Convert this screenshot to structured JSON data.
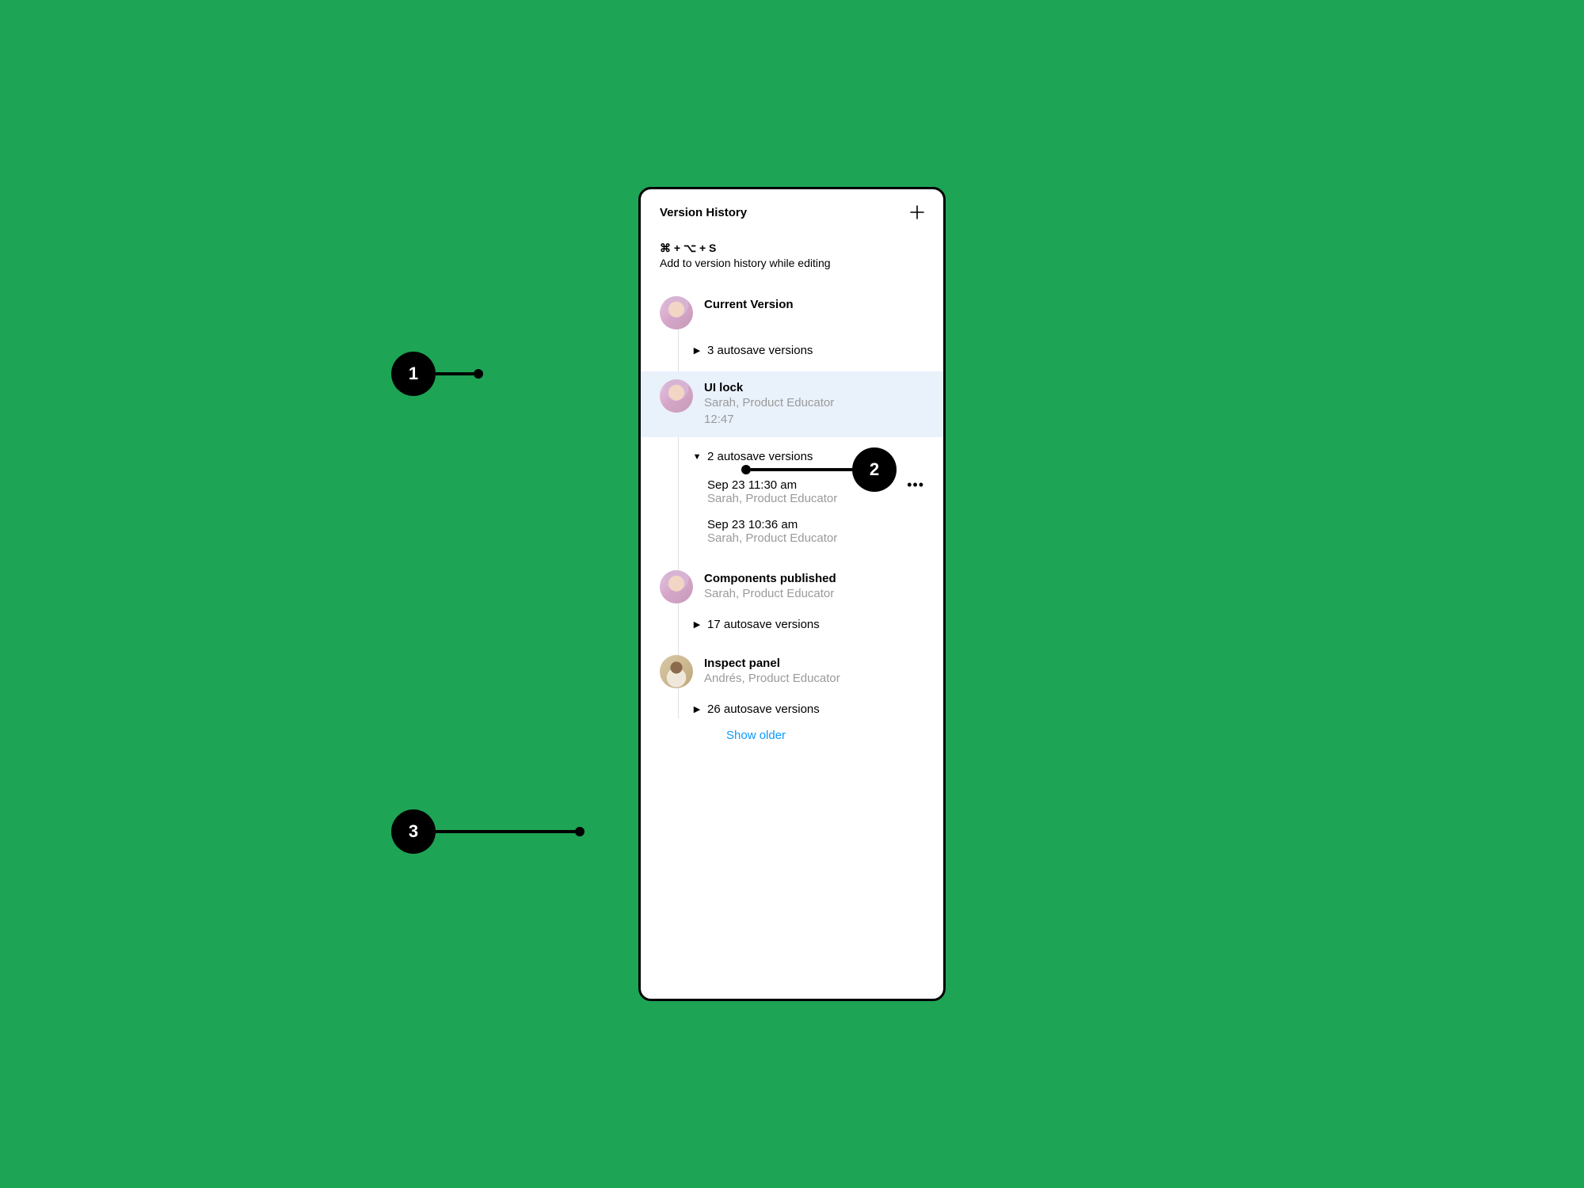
{
  "panel": {
    "title": "Version History",
    "shortcut": "⌘ + ⌥ + S",
    "shortcut_description": "Add to version history while editing",
    "show_older": "Show older"
  },
  "versions": {
    "current": {
      "title": "Current Version",
      "autosave_label": "3 autosave versions"
    },
    "ui_lock": {
      "title": "UI lock",
      "author": "Sarah, Product Educator",
      "time": "12:47",
      "autosave_label": "2 autosave versions",
      "entries": [
        {
          "time": "Sep 23 11:30 am",
          "author": "Sarah, Product Educator"
        },
        {
          "time": "Sep 23 10:36 am",
          "author": "Sarah, Product Educator"
        }
      ]
    },
    "components": {
      "title": "Components published",
      "author": "Sarah, Product Educator",
      "autosave_label": "17 autosave versions"
    },
    "inspect": {
      "title": "Inspect panel",
      "author": "Andrés, Product Educator",
      "autosave_label": "26 autosave versions"
    }
  },
  "callouts": {
    "c1": "1",
    "c2": "2",
    "c3": "3"
  }
}
